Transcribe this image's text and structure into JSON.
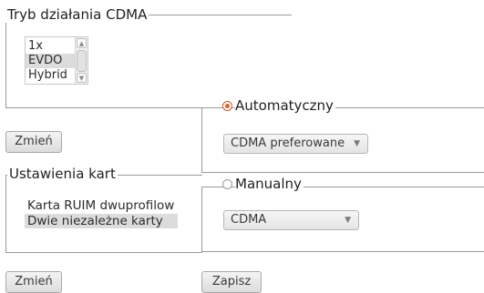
{
  "cdma_mode": {
    "title": "Tryb działania CDMA",
    "options": [
      "1x",
      "EVDO",
      "Hybrid"
    ],
    "selected": "EVDO",
    "change_button": "Zmień"
  },
  "card_settings": {
    "title": "Ustawienia kart",
    "options": [
      "Karta RUIM dwuprofilow",
      "Dwie niezależne karty"
    ],
    "selected": "Dwie niezależne karty",
    "change_button": "Zmień"
  },
  "automatic": {
    "label": "Automatyczny",
    "checked": true,
    "combo_value": "CDMA preferowane"
  },
  "manual": {
    "label": "Manualny",
    "checked": false,
    "combo_value": "CDMA"
  },
  "save_button": "Zapisz",
  "colors": {
    "radio_accent": "#e2612c",
    "frame": "#9a9a9a",
    "selection": "#dcdcdc"
  },
  "icons": {
    "scroll_up": "up-arrow-icon",
    "scroll_down": "down-arrow-icon",
    "combo": "chevron-down-icon"
  }
}
